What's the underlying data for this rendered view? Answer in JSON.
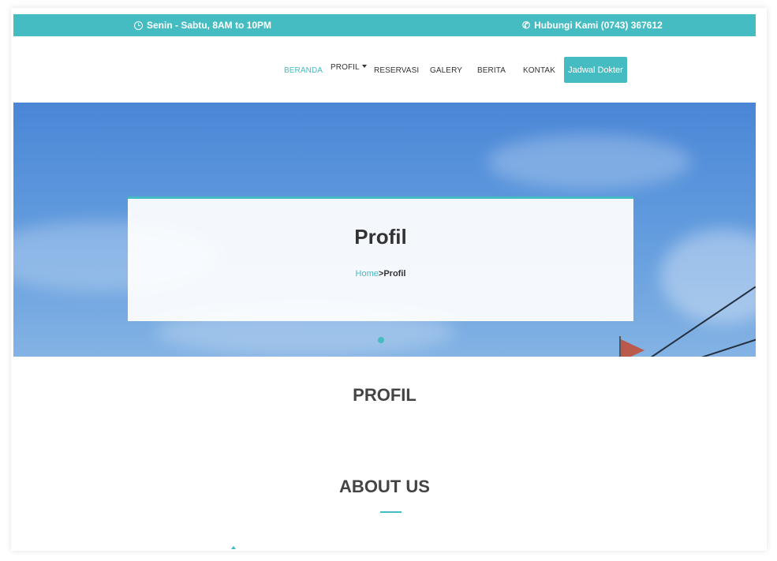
{
  "topbar": {
    "hours": "Senin - Sabtu, 8AM to 10PM",
    "contact": "Hubungi Kami (0743) 367612",
    "hours_icon": "clock-icon",
    "contact_icon": "phone-icon"
  },
  "nav": {
    "items": [
      "BERANDA",
      "PROFIL",
      "RESERVASI",
      "GALERY",
      "BERITA",
      "KONTAK"
    ],
    "active": "BERANDA",
    "button_label": "Jadwal Dokter"
  },
  "hero": {
    "title": "Profil",
    "breadcrumb_home": "Home",
    "breadcrumb_separator": ">",
    "breadcrumb_current": "Profil"
  },
  "sections": {
    "profil_heading": "PROFIL",
    "about_heading": "ABOUT US"
  },
  "colors": {
    "accent": "#45bcc2",
    "sky": "#5a95dc"
  }
}
